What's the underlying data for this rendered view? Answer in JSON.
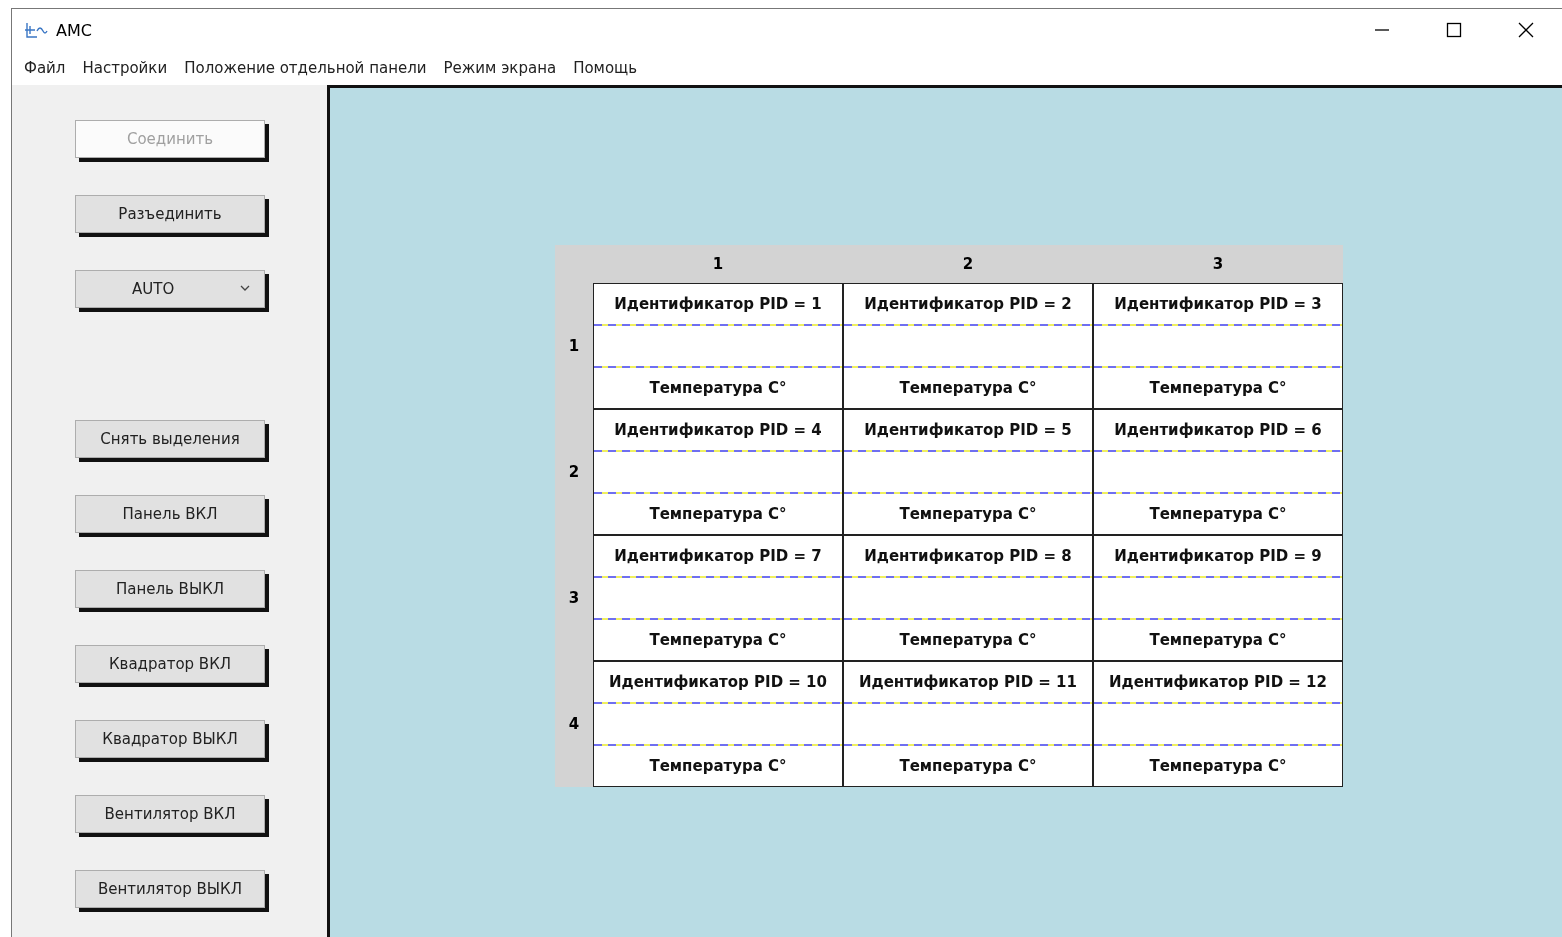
{
  "window": {
    "title": "AMC"
  },
  "menu": [
    "Файл",
    "Настройки",
    "Положение отдельной панели",
    "Режим экрана",
    "Помощь"
  ],
  "controls": [
    {
      "kind": "button",
      "label": "Соединить",
      "disabled": true
    },
    {
      "kind": "button",
      "label": "Разъединить",
      "disabled": false
    },
    {
      "kind": "dropdown",
      "label": "AUTO",
      "disabled": false
    },
    {
      "kind": "spacer"
    },
    {
      "kind": "button",
      "label": "Снять выделения",
      "disabled": false
    },
    {
      "kind": "button",
      "label": "Панель ВКЛ",
      "disabled": false
    },
    {
      "kind": "button",
      "label": "Панель ВЫКЛ",
      "disabled": false
    },
    {
      "kind": "button",
      "label": "Квадратор ВКЛ",
      "disabled": false
    },
    {
      "kind": "button",
      "label": "Квадратор ВЫКЛ",
      "disabled": false
    },
    {
      "kind": "button",
      "label": "Вентилятор ВКЛ",
      "disabled": false
    },
    {
      "kind": "button",
      "label": "Вентилятор ВЫКЛ",
      "disabled": false
    }
  ],
  "grid": {
    "columns": [
      "1",
      "2",
      "3"
    ],
    "rows": [
      {
        "header": "1",
        "cells": [
          {
            "pid": "Идентификатор PID = 1",
            "temperature": "Температура C°"
          },
          {
            "pid": "Идентификатор PID = 2",
            "temperature": "Температура C°"
          },
          {
            "pid": "Идентификатор PID = 3",
            "temperature": "Температура C°"
          }
        ]
      },
      {
        "header": "2",
        "cells": [
          {
            "pid": "Идентификатор PID = 4",
            "temperature": "Температура C°"
          },
          {
            "pid": "Идентификатор PID = 5",
            "temperature": "Температура C°"
          },
          {
            "pid": "Идентификатор PID = 6",
            "temperature": "Температура C°"
          }
        ]
      },
      {
        "header": "3",
        "cells": [
          {
            "pid": "Идентификатор PID = 7",
            "temperature": "Температура C°"
          },
          {
            "pid": "Идентификатор PID = 8",
            "temperature": "Температура C°"
          },
          {
            "pid": "Идентификатор PID = 9",
            "temperature": "Температура C°"
          }
        ]
      },
      {
        "header": "4",
        "cells": [
          {
            "pid": "Идентификатор PID = 10",
            "temperature": "Температура C°"
          },
          {
            "pid": "Идентификатор PID = 11",
            "temperature": "Температура C°"
          },
          {
            "pid": "Идентификатор PID = 12",
            "temperature": "Температура C°"
          }
        ]
      }
    ]
  }
}
